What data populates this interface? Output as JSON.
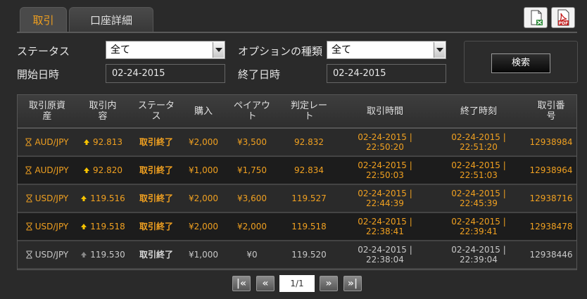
{
  "tabs": [
    {
      "label": "取引",
      "active": true
    },
    {
      "label": "口座詳細",
      "active": false
    }
  ],
  "export": {
    "excel_icon": "excel-export-icon",
    "pdf_icon": "pdf-export-icon",
    "pdf_text": "PDF"
  },
  "filters": {
    "status_label": "ステータス",
    "status_value": "全て",
    "option_label": "オプションの種類",
    "option_value": "全て",
    "start_label": "開始日時",
    "start_value": "02-24-2015",
    "end_label": "終了日時",
    "end_value": "02-24-2015",
    "search_label": "検索"
  },
  "table": {
    "headers": [
      "取引原資産",
      "取引内容",
      "ステータス",
      "購入",
      "ペイアウト",
      "判定レート",
      "取引時間",
      "終了時刻",
      "取引番号"
    ],
    "header_lines": [
      [
        "取引原資",
        "産"
      ],
      [
        "取引内",
        "容"
      ],
      [
        "ステータ",
        "ス"
      ],
      [
        "購入"
      ],
      [
        "ペイアウ",
        "ト"
      ],
      [
        "判定レー",
        "ト"
      ],
      [
        "取引時間"
      ],
      [
        "終了時刻"
      ],
      [
        "取引番",
        "号"
      ]
    ],
    "rows": [
      {
        "asset": "AUD/JPY",
        "rate": "92.813",
        "status": "取引終了",
        "purchase": "¥2,000",
        "payout": "¥3,500",
        "judge": "92.832",
        "trade_date": "02-24-2015 |",
        "trade_time": "22:50:20",
        "end_date": "02-24-2015 |",
        "end_time": "22:51:20",
        "id": "12938984",
        "won": true
      },
      {
        "asset": "AUD/JPY",
        "rate": "92.820",
        "status": "取引終了",
        "purchase": "¥1,000",
        "payout": "¥1,750",
        "judge": "92.834",
        "trade_date": "02-24-2015 |",
        "trade_time": "22:50:03",
        "end_date": "02-24-2015 |",
        "end_time": "22:51:03",
        "id": "12938964",
        "won": true
      },
      {
        "asset": "USD/JPY",
        "rate": "119.516",
        "status": "取引終了",
        "purchase": "¥2,000",
        "payout": "¥3,600",
        "judge": "119.527",
        "trade_date": "02-24-2015 |",
        "trade_time": "22:44:39",
        "end_date": "02-24-2015 |",
        "end_time": "22:45:39",
        "id": "12938716",
        "won": true
      },
      {
        "asset": "USD/JPY",
        "rate": "119.518",
        "status": "取引終了",
        "purchase": "¥2,000",
        "payout": "¥2,000",
        "judge": "119.518",
        "trade_date": "02-24-2015 |",
        "trade_time": "22:38:41",
        "end_date": "02-24-2015 |",
        "end_time": "22:39:41",
        "id": "12938478",
        "won": true
      },
      {
        "asset": "USD/JPY",
        "rate": "119.530",
        "status": "取引終了",
        "purchase": "¥1,000",
        "payout": "¥0",
        "judge": "119.520",
        "trade_date": "02-24-2015 |",
        "trade_time": "22:38:04",
        "end_date": "02-24-2015 |",
        "end_time": "22:39:04",
        "id": "12938446",
        "won": false
      }
    ]
  },
  "pager": {
    "first": "|«",
    "prev": "«",
    "page": "1/1",
    "next": "»",
    "last": "»|"
  },
  "colors": {
    "accent": "#f0a020",
    "muted": "#c8c8c8",
    "background": "#2a2a2a"
  }
}
